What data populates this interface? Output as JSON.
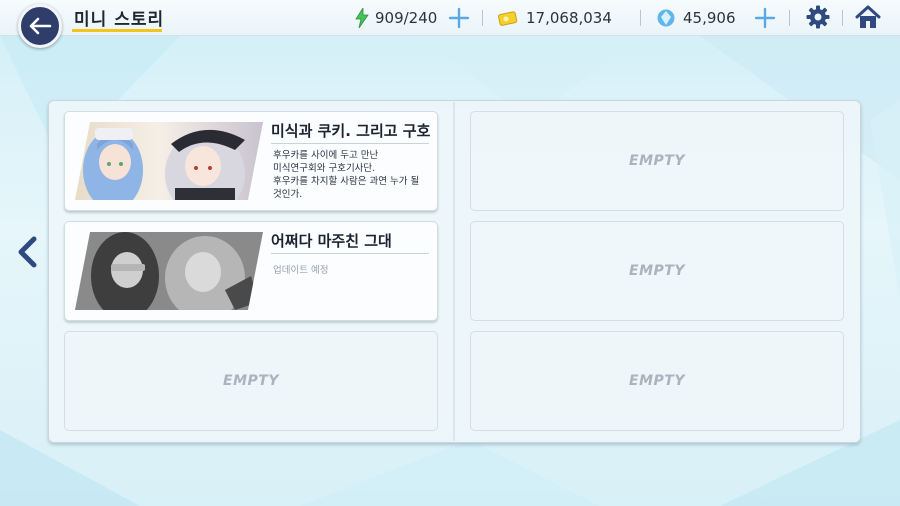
{
  "header": {
    "title": "미니 스토리"
  },
  "resources": {
    "stamina": {
      "value": "909/240",
      "icon": "lightning-icon"
    },
    "currency": {
      "value": "17,068,034",
      "icon": "ticket-coin-icon"
    },
    "gems": {
      "value": "45,906",
      "icon": "crystal-icon"
    }
  },
  "stories": [
    {
      "title": "미식과 쿠키. 그리고 구호",
      "description": "후우카를 사이에 두고 만난\n미식연구회와 구호기사단.\n후우카를 차지할 사람은 과연 누가 될\n것인가."
    },
    {
      "title": "어쩌다 마주친 그대",
      "description": "업데이트 예정"
    }
  ],
  "empty_label": "EMPTY",
  "colors": {
    "accent_yellow": "#f2c51c",
    "back_button": "#2f3d6b",
    "icon_blue": "#2f4a80",
    "plus_blue": "#5aa9e6"
  }
}
